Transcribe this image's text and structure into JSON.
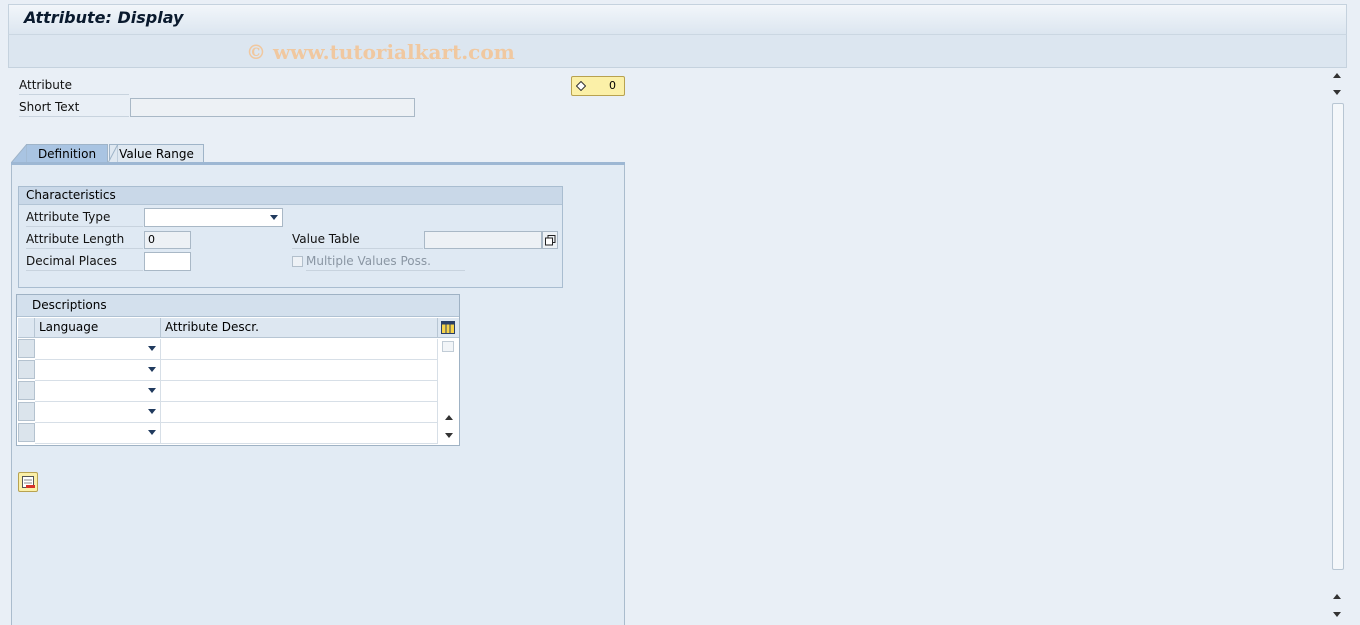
{
  "window": {
    "title": "Attribute: Display"
  },
  "watermark": "© www.tutorialkart.com",
  "header": {
    "attribute_label": "Attribute",
    "short_text_label": "Short Text",
    "short_text_value": "",
    "counter_value": "0"
  },
  "tabs": [
    {
      "label": "Definition",
      "active": true
    },
    {
      "label": "Value Range",
      "active": false
    }
  ],
  "characteristics": {
    "title": "Characteristics",
    "attribute_type_label": "Attribute Type",
    "attribute_type_value": "",
    "attribute_length_label": "Attribute Length",
    "attribute_length_value": "0",
    "decimal_places_label": "Decimal Places",
    "decimal_places_value": "",
    "value_table_label": "Value Table",
    "value_table_value": "",
    "multiple_values_label": "Multiple Values Poss.",
    "multiple_values_checked": false
  },
  "descriptions": {
    "title": "Descriptions",
    "columns": [
      "Language",
      "Attribute Descr."
    ],
    "rows": [
      {
        "language": "",
        "descr": ""
      },
      {
        "language": "",
        "descr": ""
      },
      {
        "language": "",
        "descr": ""
      },
      {
        "language": "",
        "descr": ""
      },
      {
        "language": "",
        "descr": ""
      }
    ]
  },
  "colors": {
    "counter_bg": "#fbf0a8",
    "active_tab": "#a9c4e2",
    "watermark": "#f0c8a0"
  }
}
